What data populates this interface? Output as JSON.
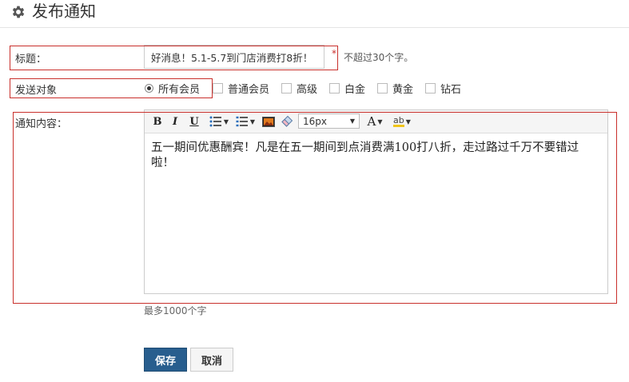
{
  "header": {
    "title": "发布通知",
    "icon": "gear-icon"
  },
  "form": {
    "title_label": "标题：",
    "title_value": "好消息！5.1-5.7到门店消费打8折！",
    "required_mark": "*",
    "title_hint": "不超过30个字。",
    "target_label": "发送对象",
    "target_options": [
      {
        "label": "所有会员",
        "type": "radio",
        "selected": true
      },
      {
        "label": "普通会员",
        "type": "checkbox",
        "checked": false
      },
      {
        "label": "高级",
        "type": "checkbox",
        "checked": false
      },
      {
        "label": "白金",
        "type": "checkbox",
        "checked": false
      },
      {
        "label": "黄金",
        "type": "checkbox",
        "checked": false
      },
      {
        "label": "钻石",
        "type": "checkbox",
        "checked": false
      }
    ],
    "content_label": "通知内容：",
    "editor": {
      "toolbar": {
        "bold": "B",
        "italic": "I",
        "underline": "U",
        "font_size": "16px",
        "font_color": "A",
        "highlight": "ab"
      },
      "content": "五一期间优惠酬宾！凡是在五一期间到点消费满100打八折，走过路过千万不要错过啦！"
    },
    "content_limit": "最多1000个字",
    "save_label": "保存",
    "cancel_label": "取消"
  },
  "colors": {
    "primary_button": "#285e8e",
    "highlight_border": "#c9302c"
  }
}
